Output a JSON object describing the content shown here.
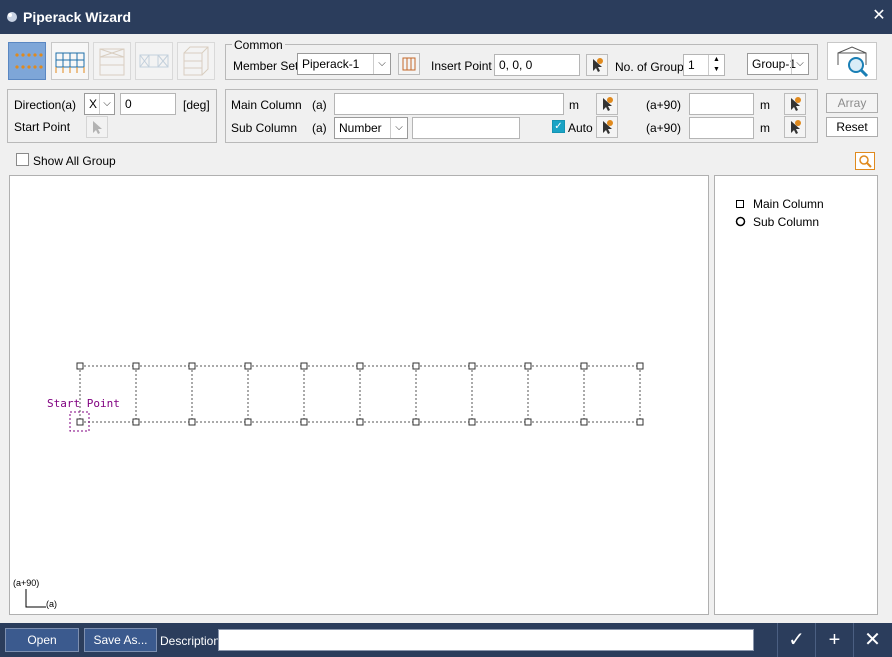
{
  "window": {
    "title": "Piperack Wizard"
  },
  "toolbar": {
    "icons": [
      "grid-points-icon",
      "frame-plan-icon",
      "elevation-icon",
      "bracing-plan-icon",
      "3d-frame-icon"
    ]
  },
  "common": {
    "group_label": "Common",
    "member_set_label": "Member Set",
    "member_set_value": "Piperack-1",
    "insert_point_label": "Insert Point",
    "insert_point_value": "0, 0, 0",
    "no_of_group_label": "No. of Group",
    "no_of_group_value": "1",
    "group_select_value": "Group-1"
  },
  "direction": {
    "label": "Direction(a)",
    "axis_value": "X",
    "angle_value": "0",
    "angle_unit": "[deg]",
    "start_point_label": "Start Point"
  },
  "columns": {
    "main_label": "Main Column",
    "sub_label": "Sub Column",
    "a_label": "(a)",
    "a90_label": "(a+90)",
    "unit_m": "m",
    "main_a_value": "",
    "main_a90_value": "",
    "sub_type_value": "Number",
    "sub_a_value": "",
    "sub_a90_value": "",
    "auto_label": "Auto",
    "auto_checked": true
  },
  "actions": {
    "array_label": "Array",
    "reset_label": "Reset"
  },
  "options": {
    "show_all_group_label": "Show All Group"
  },
  "canvas": {
    "start_point_text": "Start Point",
    "axis_a90_label": "(a+90)",
    "axis_a_label": "(a)"
  },
  "legend": {
    "main_column_label": "Main Column",
    "sub_column_label": "Sub Column"
  },
  "bottom": {
    "open_label": "Open",
    "save_as_label": "Save As...",
    "description_label": "Description",
    "description_value": ""
  },
  "colors": {
    "titlebar": "#2b3d5c",
    "accent": "#1aa3c5",
    "start_point": "#800080"
  }
}
